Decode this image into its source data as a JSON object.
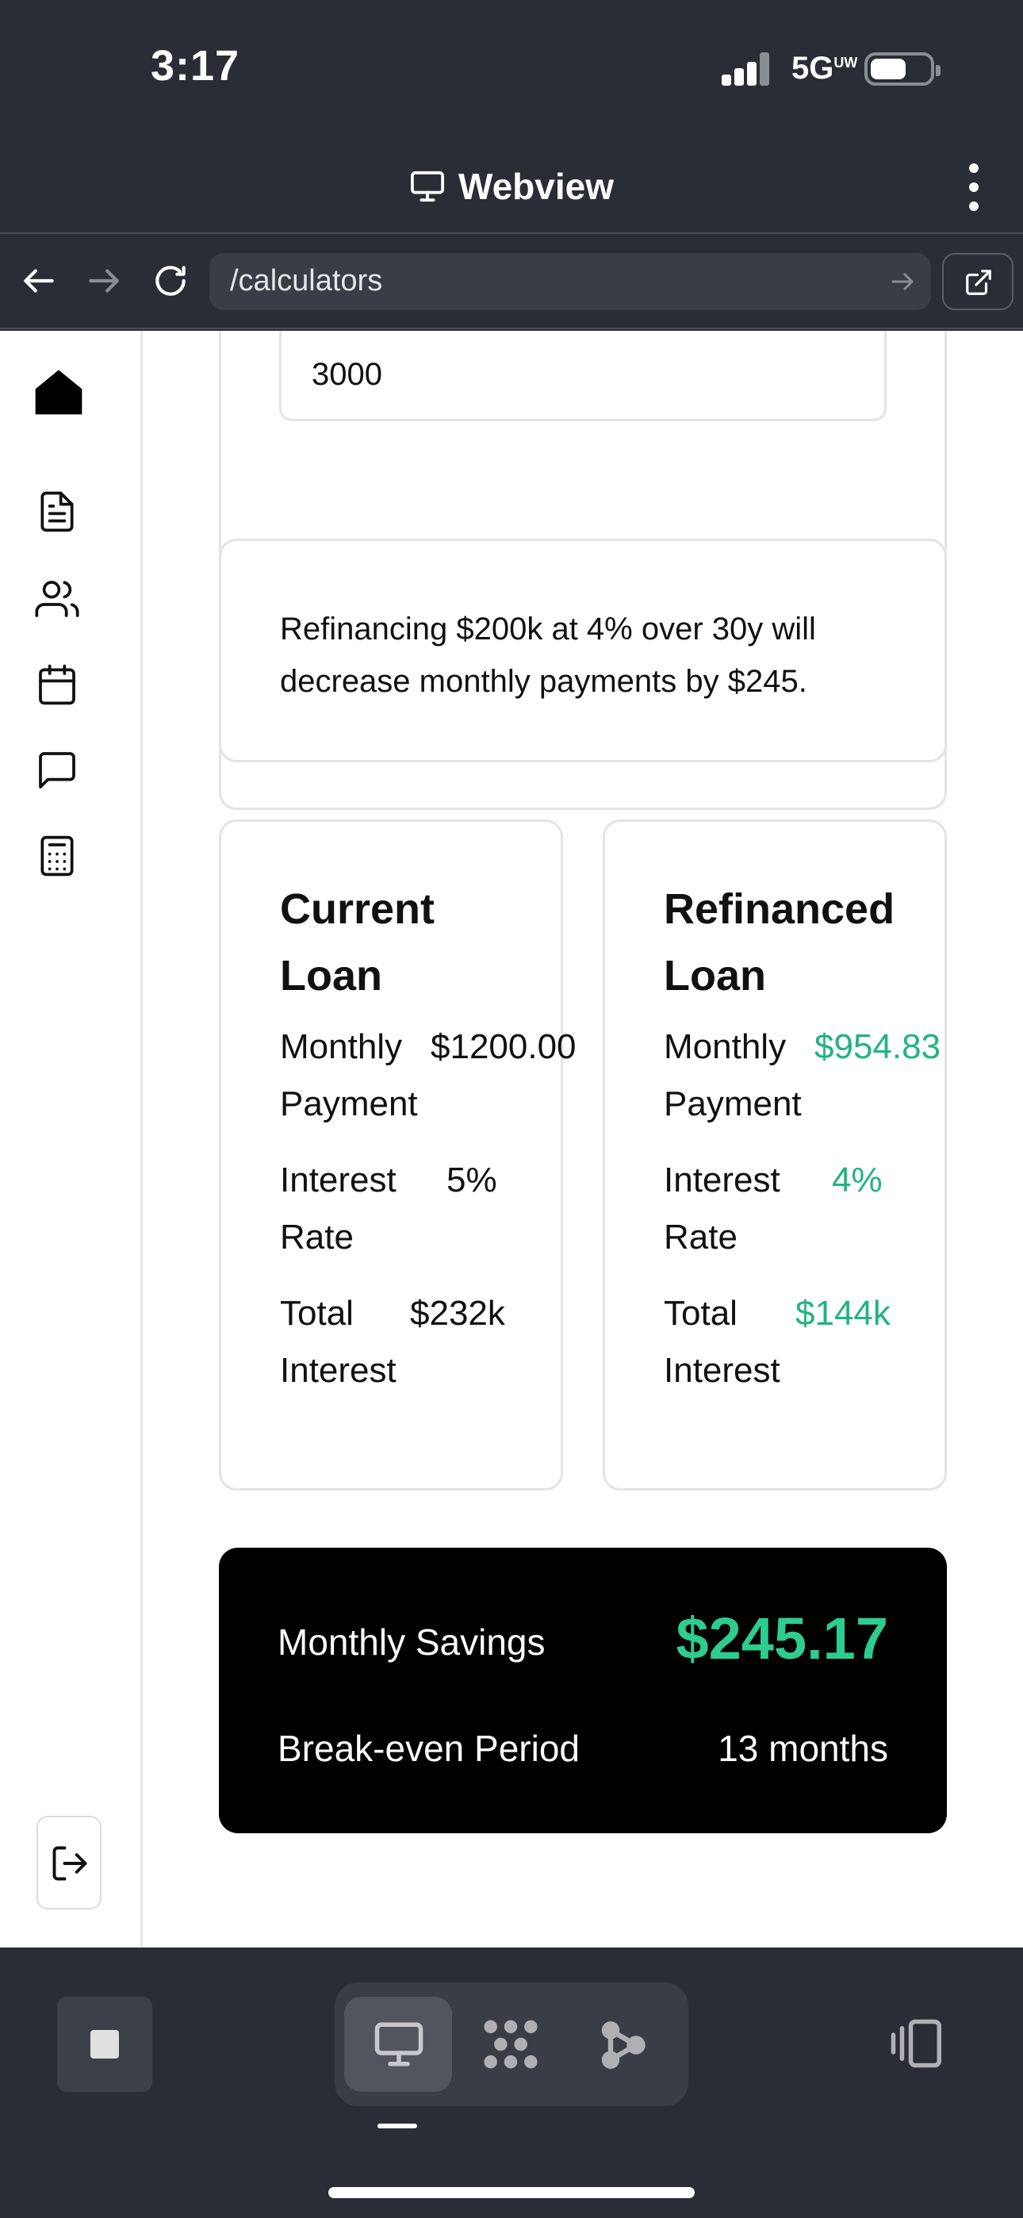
{
  "status_bar": {
    "time": "3:17",
    "network": "5G",
    "network_sup": "UW"
  },
  "title_bar": {
    "title": "Webview"
  },
  "url_bar": {
    "url": "/calculators"
  },
  "sidebar": {
    "items": [
      "home-icon",
      "document-icon",
      "users-icon",
      "calendar-icon",
      "chat-icon",
      "calculator-icon"
    ],
    "logout_icon": "logout-icon"
  },
  "calculator": {
    "input_value": "3000",
    "summary": "Refinancing $200k at 4% over 30y will decrease monthly payments by $245.",
    "current_loan": {
      "title": "Current Loan",
      "monthly_payment_label": "Monthly Payment",
      "monthly_payment": "$1200.00",
      "interest_rate_label": "Interest Rate",
      "interest_rate": "5%",
      "total_interest_label": "Total Interest",
      "total_interest": "$232k"
    },
    "refinanced_loan": {
      "title": "Refinanced Loan",
      "monthly_payment_label": "Monthly Payment",
      "monthly_payment": "$954.83",
      "interest_rate_label": "Interest Rate",
      "interest_rate": "4%",
      "total_interest_label": "Total Interest",
      "total_interest": "$144k"
    },
    "savings": {
      "monthly_savings_label": "Monthly Savings",
      "monthly_savings": "$245.17",
      "break_even_label": "Break-even Period",
      "break_even": "13 months"
    }
  },
  "colors": {
    "accent_green": "#21b383",
    "savings_green": "#2ecc8f",
    "chrome": "#2a2d35"
  }
}
